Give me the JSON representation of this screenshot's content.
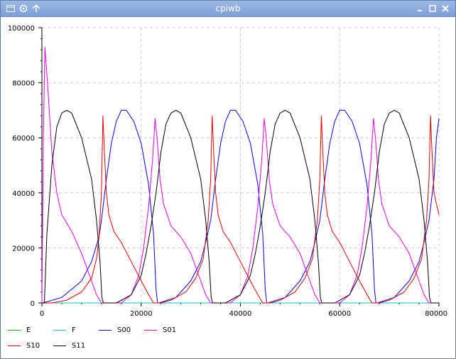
{
  "window": {
    "title": "cpiwb"
  },
  "chart_data": {
    "type": "line",
    "xlim": [
      0,
      80000
    ],
    "ylim": [
      0,
      100000
    ],
    "xticks": [
      0,
      20000,
      40000,
      60000,
      80000
    ],
    "yticks": [
      0,
      20000,
      40000,
      60000,
      80000,
      100000
    ],
    "grid": true,
    "legend_position": "bottom",
    "series": [
      {
        "name": "E",
        "color": "#00c800",
        "x": [
          0,
          80000
        ],
        "y": [
          0,
          0
        ]
      },
      {
        "name": "F",
        "color": "#00c8c8",
        "x": [
          0,
          80000
        ],
        "y": [
          0,
          0
        ]
      },
      {
        "name": "S00",
        "color": "#0000ff",
        "x": [
          0,
          200,
          4000,
          8000,
          10000,
          11500,
          12000,
          13000,
          14000,
          15000,
          16000,
          17000,
          18500,
          20000,
          21500,
          22500,
          23000,
          23300,
          23600,
          27000,
          30000,
          32000,
          33000,
          34000,
          35000,
          36000,
          37000,
          38000,
          39000,
          40500,
          42000,
          43500,
          44500,
          45000,
          45300,
          45600,
          49000,
          52000,
          54000,
          55000,
          56000,
          57000,
          58000,
          59000,
          60000,
          61000,
          62500,
          64000,
          65500,
          66500,
          67000,
          67300,
          67600,
          71000,
          74000,
          76000,
          77000,
          78000,
          79000,
          79500,
          80000
        ],
        "y": [
          0,
          0,
          2000,
          8000,
          15000,
          24000,
          30000,
          45000,
          58000,
          66000,
          70000,
          70000,
          66000,
          58000,
          43000,
          25000,
          5000,
          0,
          0,
          2000,
          8000,
          15000,
          22000,
          30000,
          45000,
          58000,
          66000,
          70000,
          70000,
          66000,
          58000,
          43000,
          25000,
          5000,
          0,
          0,
          2000,
          8000,
          15000,
          22000,
          30000,
          45000,
          58000,
          66000,
          70000,
          70000,
          66000,
          58000,
          43000,
          25000,
          5000,
          0,
          0,
          2000,
          8000,
          15000,
          22000,
          30000,
          45000,
          60000,
          67000
        ]
      },
      {
        "name": "S01",
        "color": "#e600e6",
        "x": [
          0,
          300,
          600,
          1200,
          2000,
          3000,
          4000,
          6000,
          8000,
          10000,
          11000,
          12000,
          12300,
          13000,
          16000,
          18000,
          19500,
          20500,
          21500,
          22300,
          22800,
          23200,
          23800,
          24500,
          26000,
          28000,
          30000,
          32000,
          33000,
          34000,
          34500,
          35000,
          38000,
          40000,
          41500,
          42500,
          43500,
          44300,
          44800,
          45200,
          45800,
          46500,
          48000,
          50000,
          52000,
          54000,
          55000,
          56000,
          56500,
          57000,
          60000,
          62000,
          63500,
          64500,
          65500,
          66300,
          66800,
          67200,
          67800,
          68500,
          70000,
          72000,
          74000,
          76000,
          77000,
          78000,
          78500,
          80000
        ],
        "y": [
          0,
          60000,
          93000,
          78000,
          55000,
          40000,
          32000,
          26000,
          18000,
          8000,
          3000,
          0,
          0,
          0,
          0,
          3000,
          10000,
          20000,
          35000,
          52000,
          67000,
          60000,
          45000,
          36000,
          28000,
          24000,
          18000,
          8000,
          3000,
          0,
          0,
          0,
          0,
          3000,
          10000,
          20000,
          35000,
          52000,
          67000,
          60000,
          45000,
          36000,
          28000,
          24000,
          18000,
          8000,
          3000,
          0,
          0,
          0,
          0,
          3000,
          10000,
          20000,
          35000,
          52000,
          67000,
          60000,
          45000,
          36000,
          28000,
          24000,
          18000,
          8000,
          3000,
          0,
          0,
          0
        ]
      },
      {
        "name": "S10",
        "color": "#e60000",
        "x": [
          0,
          2000,
          5000,
          8000,
          10000,
          11000,
          11500,
          12000,
          12300,
          12600,
          13000,
          13500,
          14500,
          16000,
          18000,
          20000,
          21500,
          22500,
          23300,
          24000,
          26000,
          29000,
          31000,
          32500,
          33500,
          34000,
          34300,
          34600,
          35000,
          35500,
          36500,
          38000,
          40000,
          42000,
          43500,
          44500,
          45300,
          46000,
          48000,
          51000,
          53000,
          54500,
          55500,
          56000,
          56300,
          56600,
          57000,
          57500,
          58500,
          60000,
          62000,
          64000,
          65500,
          66500,
          67300,
          68000,
          70000,
          73000,
          75000,
          76500,
          77500,
          78000,
          78300,
          78600,
          79000,
          80000
        ],
        "y": [
          0,
          0,
          1000,
          4000,
          9000,
          16000,
          24000,
          40000,
          68000,
          55000,
          40000,
          32000,
          26000,
          22000,
          15000,
          8000,
          3000,
          0,
          0,
          0,
          1000,
          4000,
          9000,
          16000,
          30000,
          45000,
          68000,
          55000,
          40000,
          32000,
          26000,
          22000,
          15000,
          8000,
          3000,
          0,
          0,
          0,
          1000,
          4000,
          9000,
          16000,
          30000,
          45000,
          68000,
          55000,
          40000,
          32000,
          26000,
          22000,
          15000,
          8000,
          3000,
          0,
          0,
          0,
          1000,
          4000,
          9000,
          16000,
          30000,
          45000,
          68000,
          55000,
          40000,
          32000
        ]
      },
      {
        "name": "S11",
        "color": "#000000",
        "x": [
          0,
          500,
          1000,
          2000,
          3000,
          4000,
          5000,
          6000,
          8000,
          10000,
          11000,
          11700,
          12100,
          12400,
          13000,
          15000,
          18000,
          20000,
          21000,
          22000,
          23000,
          24000,
          25000,
          26000,
          27000,
          28000,
          30000,
          32000,
          33000,
          33700,
          34100,
          34400,
          35000,
          37000,
          40000,
          42000,
          43000,
          44000,
          45000,
          46000,
          47000,
          48000,
          49000,
          50000,
          52000,
          54000,
          55000,
          55700,
          56100,
          56400,
          57000,
          59000,
          62000,
          64000,
          65000,
          66000,
          67000,
          68000,
          69000,
          70000,
          71000,
          72000,
          74000,
          76000,
          77000,
          77700,
          78100,
          78400,
          80000
        ],
        "y": [
          0,
          0,
          25000,
          50000,
          64000,
          69000,
          70000,
          69000,
          60000,
          45000,
          30000,
          15000,
          2000,
          0,
          0,
          0,
          3000,
          10000,
          18000,
          28000,
          40000,
          55000,
          65000,
          69000,
          70000,
          69000,
          60000,
          45000,
          30000,
          15000,
          2000,
          0,
          0,
          0,
          3000,
          10000,
          18000,
          28000,
          40000,
          55000,
          65000,
          69000,
          70000,
          69000,
          60000,
          45000,
          30000,
          15000,
          2000,
          0,
          0,
          0,
          3000,
          10000,
          18000,
          28000,
          40000,
          55000,
          65000,
          69000,
          70000,
          69000,
          60000,
          45000,
          30000,
          15000,
          2000,
          0,
          0
        ]
      }
    ]
  }
}
